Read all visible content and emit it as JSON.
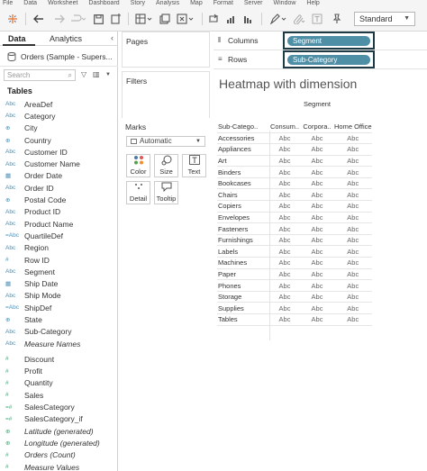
{
  "menu": [
    "File",
    "Data",
    "Worksheet",
    "Dashboard",
    "Story",
    "Analysis",
    "Map",
    "Format",
    "Server",
    "Window",
    "Help"
  ],
  "toolbar": {
    "fit_mode": "Standard"
  },
  "data_pane": {
    "tabs": {
      "data": "Data",
      "analytics": "Analytics"
    },
    "source": "Orders (Sample - Supers...",
    "search_placeholder": "Search",
    "tables_heading": "Tables",
    "fields": [
      {
        "icon": "Abc",
        "name": "AreaDef",
        "style": "normal",
        "kind": "dim"
      },
      {
        "icon": "Abc",
        "name": "Category",
        "style": "normal",
        "kind": "dim"
      },
      {
        "icon": "⊕",
        "name": "City",
        "style": "normal",
        "kind": "dim"
      },
      {
        "icon": "⊕",
        "name": "Country",
        "style": "normal",
        "kind": "dim"
      },
      {
        "icon": "Abc",
        "name": "Customer ID",
        "style": "normal",
        "kind": "dim"
      },
      {
        "icon": "Abc",
        "name": "Customer Name",
        "style": "normal",
        "kind": "dim"
      },
      {
        "icon": "▦",
        "name": "Order Date",
        "style": "normal",
        "kind": "dim"
      },
      {
        "icon": "Abc",
        "name": "Order ID",
        "style": "normal",
        "kind": "dim"
      },
      {
        "icon": "⊕",
        "name": "Postal Code",
        "style": "normal",
        "kind": "dim"
      },
      {
        "icon": "Abc",
        "name": "Product ID",
        "style": "normal",
        "kind": "dim"
      },
      {
        "icon": "Abc",
        "name": "Product Name",
        "style": "normal",
        "kind": "dim"
      },
      {
        "icon": "=Abc",
        "name": "QuartileDef",
        "style": "normal",
        "kind": "dim"
      },
      {
        "icon": "Abc",
        "name": "Region",
        "style": "normal",
        "kind": "dim"
      },
      {
        "icon": "#",
        "name": "Row ID",
        "style": "normal",
        "kind": "dim"
      },
      {
        "icon": "Abc",
        "name": "Segment",
        "style": "normal",
        "kind": "dim"
      },
      {
        "icon": "▦",
        "name": "Ship Date",
        "style": "normal",
        "kind": "dim"
      },
      {
        "icon": "Abc",
        "name": "Ship Mode",
        "style": "normal",
        "kind": "dim"
      },
      {
        "icon": "=Abc",
        "name": "ShipDef",
        "style": "normal",
        "kind": "dim"
      },
      {
        "icon": "⊕",
        "name": "State",
        "style": "normal",
        "kind": "dim"
      },
      {
        "icon": "Abc",
        "name": "Sub-Category",
        "style": "normal",
        "kind": "dim"
      },
      {
        "icon": "Abc",
        "name": "Measure Names",
        "style": "italic",
        "kind": "dim"
      },
      {
        "icon": "#",
        "name": "Discount",
        "style": "normal",
        "kind": "meas"
      },
      {
        "icon": "#",
        "name": "Profit",
        "style": "normal",
        "kind": "meas"
      },
      {
        "icon": "#",
        "name": "Quantity",
        "style": "normal",
        "kind": "meas"
      },
      {
        "icon": "#",
        "name": "Sales",
        "style": "normal",
        "kind": "meas"
      },
      {
        "icon": "=#",
        "name": "SalesCategory",
        "style": "normal",
        "kind": "meas"
      },
      {
        "icon": "=#",
        "name": "SalesCategory_if",
        "style": "normal",
        "kind": "meas"
      },
      {
        "icon": "⊕",
        "name": "Latitude (generated)",
        "style": "italic",
        "kind": "meas"
      },
      {
        "icon": "⊕",
        "name": "Longitude (generated)",
        "style": "italic",
        "kind": "meas"
      },
      {
        "icon": "#",
        "name": "Orders (Count)",
        "style": "italic",
        "kind": "meas"
      },
      {
        "icon": "#",
        "name": "Measure Values",
        "style": "italic",
        "kind": "meas"
      }
    ]
  },
  "cards": {
    "pages": "Pages",
    "filters": "Filters",
    "marks": "Marks",
    "mark_type": "Automatic",
    "mark_buttons": [
      {
        "icon": "●●",
        "label": "Color"
      },
      {
        "icon": "◯",
        "label": "Size"
      },
      {
        "icon": "T",
        "label": "Text"
      },
      {
        "icon": "⁘",
        "label": "Detail"
      },
      {
        "icon": "▭",
        "label": "Tooltip"
      }
    ]
  },
  "shelves": {
    "columns_label": "Columns",
    "columns_pill": "Segment",
    "rows_label": "Rows",
    "rows_pill": "Sub-Category"
  },
  "sheet": {
    "title": "Heatmap with dimension",
    "column_header_title": "Segment",
    "row_header_title": "Sub-Catego..",
    "columns": [
      "Consum..",
      "Corpora..",
      "Home Office"
    ],
    "cell_text": "Abc",
    "rows": [
      "Accessories",
      "Appliances",
      "Art",
      "Binders",
      "Bookcases",
      "Chairs",
      "Copiers",
      "Envelopes",
      "Fasteners",
      "Furnishings",
      "Labels",
      "Machines",
      "Paper",
      "Phones",
      "Storage",
      "Supplies",
      "Tables"
    ]
  }
}
